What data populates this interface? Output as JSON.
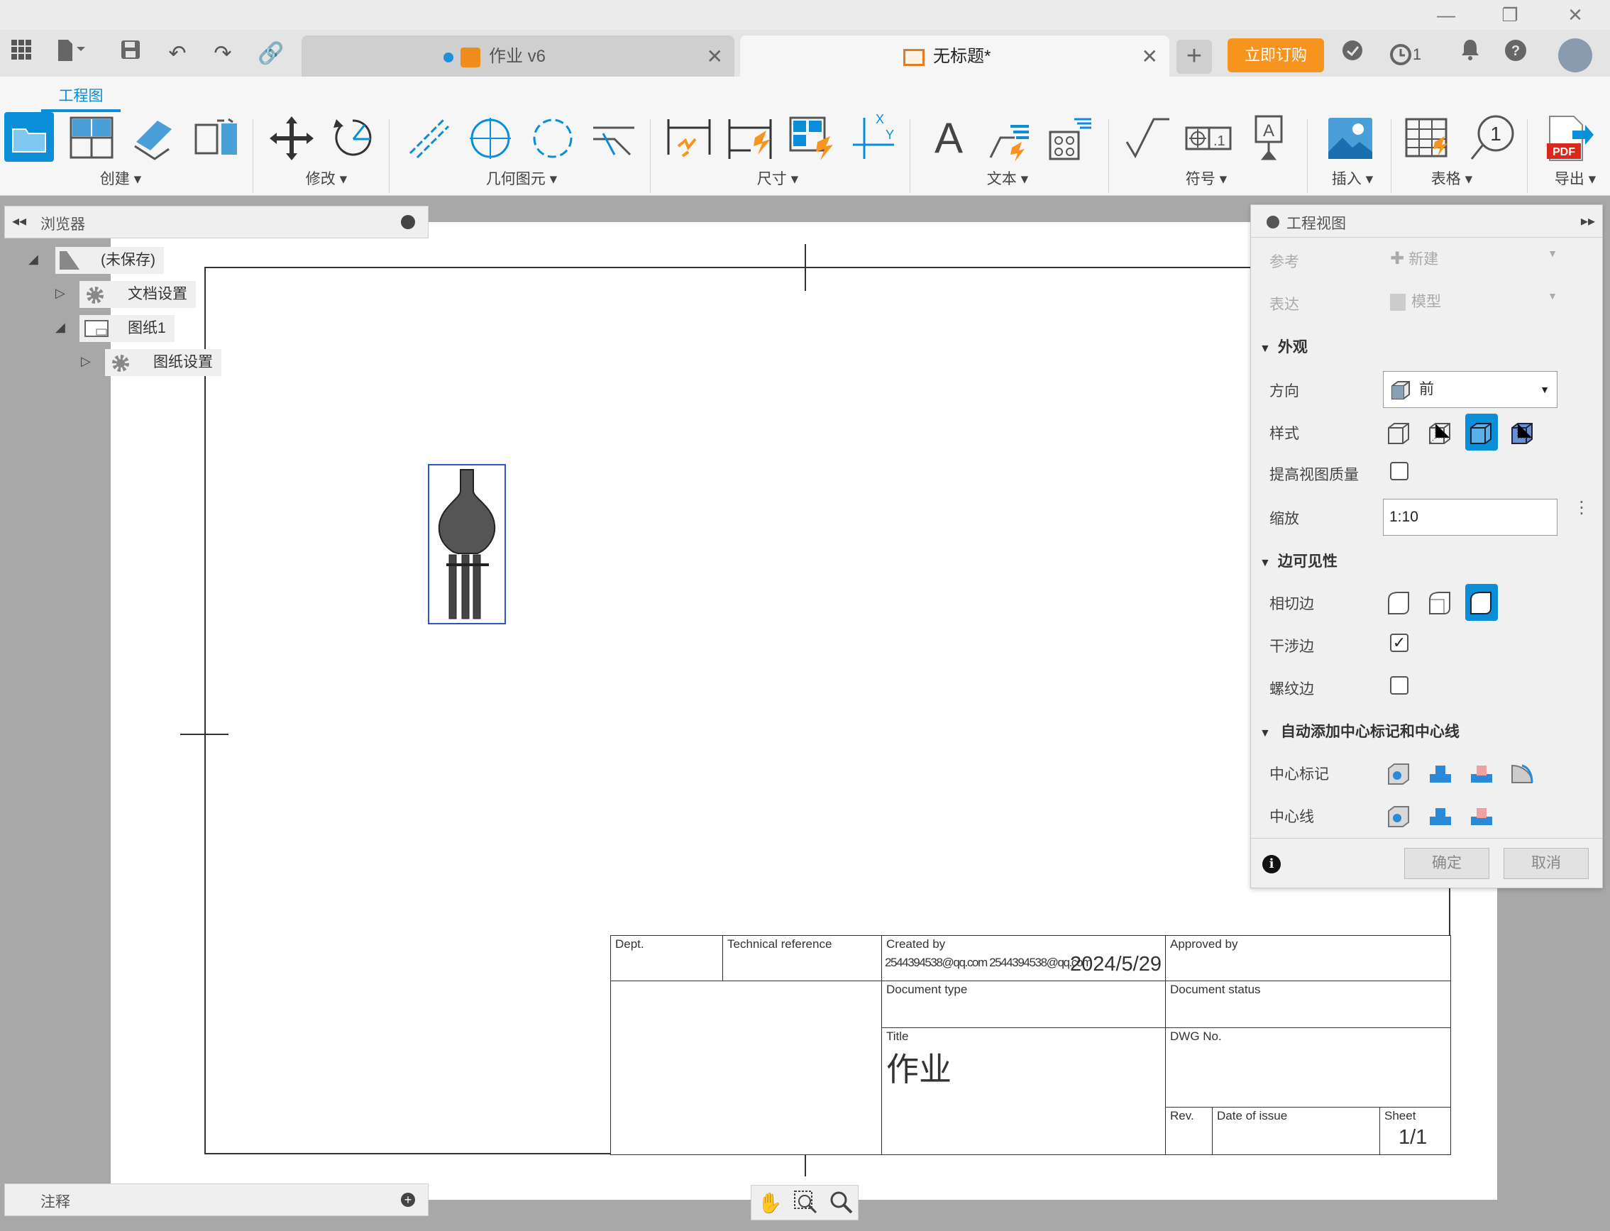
{
  "window": {
    "minimize": "—",
    "restore": "❐",
    "close": "✕"
  },
  "appbar": {
    "tabs": [
      {
        "label": "作业 v6",
        "close": "✕"
      },
      {
        "label": "无标题*",
        "close": "✕"
      }
    ],
    "new_tab": "+",
    "buy_label": "立即订购",
    "jobs_count": "1"
  },
  "ribbon": {
    "active_tab": "工程图",
    "groups": [
      "创建 ▾",
      "修改 ▾",
      "几何图元 ▾",
      "尺寸 ▾",
      "文本 ▾",
      "符号 ▾",
      "插入 ▾",
      "表格 ▾",
      "导出 ▾"
    ],
    "text_icon": "A",
    "balloon_number": "1",
    "pdf_label": "PDF"
  },
  "browser": {
    "title": "浏览器",
    "items": [
      {
        "label": "(未保存)"
      },
      {
        "label": "文档设置"
      },
      {
        "label": "图纸1"
      },
      {
        "label": "图纸设置"
      }
    ]
  },
  "notes": {
    "title": "注释"
  },
  "dialog": {
    "title": "工程视图",
    "reference_label": "参考",
    "reference_value": "新建",
    "representation_label": "表达",
    "representation_value": "模型",
    "appearance_section": "外观",
    "orientation_label": "方向",
    "orientation_value": "前",
    "style_label": "样式",
    "quality_label": "提高视图质量",
    "scale_label": "缩放",
    "scale_value": "1:10",
    "edge_section": "边可见性",
    "tangent_label": "相切边",
    "interference_label": "干涉边",
    "thread_label": "螺纹边",
    "center_section": "自动添加中心标记和中心线",
    "centermark_label": "中心标记",
    "centerline_label": "中心线",
    "ok_label": "确定",
    "cancel_label": "取消",
    "interference_checked": true,
    "quality_checked": false,
    "thread_checked": false
  },
  "titleblock": {
    "dept": "Dept.",
    "tech_ref": "Technical reference",
    "created_by": "Created by",
    "creator": "2544394538@qq.com 2544394538@qq.com",
    "date": "2024/5/29",
    "approved_by": "Approved by",
    "doc_type": "Document type",
    "doc_status": "Document status",
    "title_label": "Title",
    "title_value": "作业",
    "dwg_no": "DWG No.",
    "rev": "Rev.",
    "date_issue": "Date of issue",
    "sheet": "Sheet",
    "sheet_value": "1/1"
  },
  "colors": {
    "accent": "#0a8ed8",
    "buy": "#f7941d"
  }
}
